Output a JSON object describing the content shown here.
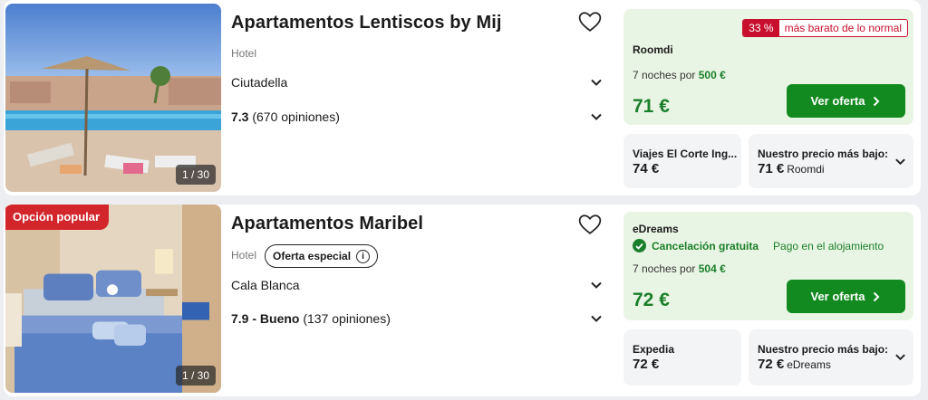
{
  "listings": [
    {
      "title": "Apartamentos Lentiscos by Mij",
      "type": "Hotel",
      "location": "Ciutadella",
      "rating": "7.3",
      "reviews": "(670 opiniones)",
      "photo_counter": "1 / 30",
      "deal": {
        "discount_pct": "33 %",
        "discount_text": "más barato de lo normal",
        "provider": "Roomdi",
        "nights_prefix": "7 noches por",
        "nights_total": "500 €",
        "price": "71 €",
        "cta": "Ver oferta"
      },
      "alt1": {
        "provider": "Viajes El Corte Ing...",
        "price": "74 €"
      },
      "alt2": {
        "label": "Nuestro precio más bajo:",
        "price": "71 €",
        "provider": "Roomdi"
      }
    },
    {
      "title": "Apartamentos Maribel",
      "badge": "Opción popular",
      "type": "Hotel",
      "special": "Oferta especial",
      "location": "Cala Blanca",
      "rating": "7.9 - Bueno",
      "reviews": "(137 opiniones)",
      "photo_counter": "1 / 30",
      "deal": {
        "provider": "eDreams",
        "cancel": "Cancelación gratuita",
        "pay": "Pago en el alojamiento",
        "nights_prefix": "7 noches por",
        "nights_total": "504 €",
        "price": "72 €",
        "cta": "Ver oferta"
      },
      "alt1": {
        "provider": "Expedia",
        "price": "72 €"
      },
      "alt2": {
        "label": "Nuestro precio más bajo:",
        "price": "72 €",
        "provider": "eDreams"
      }
    }
  ],
  "icons": [
    "heart-icon",
    "chevron-down-icon",
    "chevron-right-icon",
    "check-circle-icon",
    "info-icon"
  ],
  "colors": {
    "green": "#128a1f",
    "red": "#c8102e",
    "deal_bg": "#e9f5e4"
  }
}
